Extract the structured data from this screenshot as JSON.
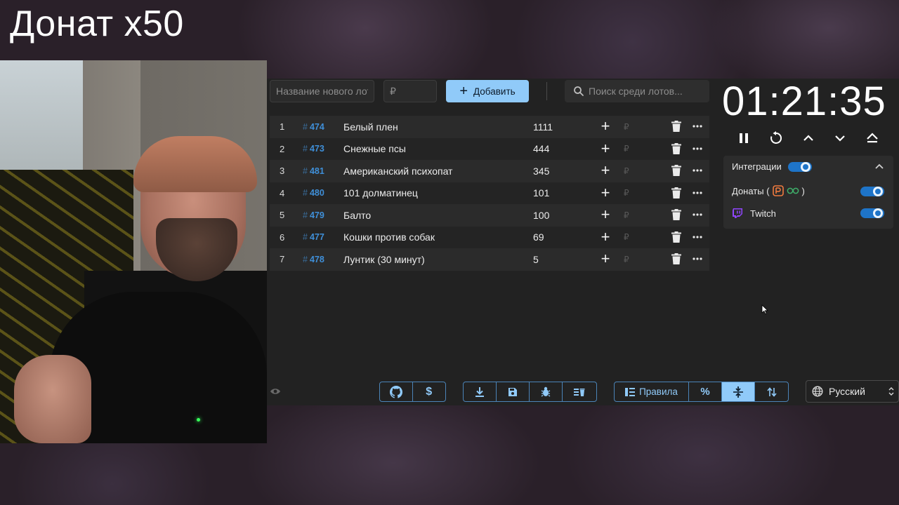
{
  "overlay": {
    "title": "Донат x50"
  },
  "toolbar": {
    "lot_name_placeholder": "Название нового лота",
    "amount_placeholder": "₽",
    "add_label": "Добавить",
    "search_placeholder": "Поиск среди лотов..."
  },
  "lots": [
    {
      "pos": "1",
      "id": "474",
      "name": "Белый плен",
      "sum": "1111"
    },
    {
      "pos": "2",
      "id": "473",
      "name": "Снежные псы",
      "sum": "444"
    },
    {
      "pos": "3",
      "id": "481",
      "name": "Американский психопат",
      "sum": "345"
    },
    {
      "pos": "4",
      "id": "480",
      "name": "101 долматинец",
      "sum": "101"
    },
    {
      "pos": "5",
      "id": "479",
      "name": "Балто",
      "sum": "100"
    },
    {
      "pos": "6",
      "id": "477",
      "name": "Кошки против собак",
      "sum": "69"
    },
    {
      "pos": "7",
      "id": "478",
      "name": "Лунтик (30 минут)",
      "sum": "5"
    }
  ],
  "lot_row": {
    "hash": "#",
    "rub": "₽"
  },
  "bottom": {
    "rules_label": "Правила",
    "percent_label": "%",
    "language": "Русский"
  },
  "timer": {
    "value": "01:21:35"
  },
  "integrations": {
    "title": "Интеграции",
    "enabled": true,
    "items": [
      {
        "label_prefix": "Донаты (",
        "label_suffix": ")",
        "enabled": true
      },
      {
        "label": "Twitch",
        "enabled": true
      }
    ]
  },
  "colors": {
    "accent": "#90caf9",
    "lot_id": "#3f8fd8",
    "panel_bg": "#222222",
    "toggle": "#1e74c8",
    "twitch": "#9146ff"
  },
  "icons": {
    "timer_controls": [
      "pause-icon",
      "restart-icon",
      "chevron-up-icon",
      "chevron-down-icon",
      "eject-icon"
    ],
    "group1": [
      "github-icon",
      "dollar-icon"
    ],
    "group2": [
      "download-icon",
      "save-icon",
      "bug-icon",
      "clear-list-icon"
    ],
    "group3": [
      "rules-icon",
      "percent-icon",
      "compress-icon",
      "sort-icon"
    ]
  }
}
